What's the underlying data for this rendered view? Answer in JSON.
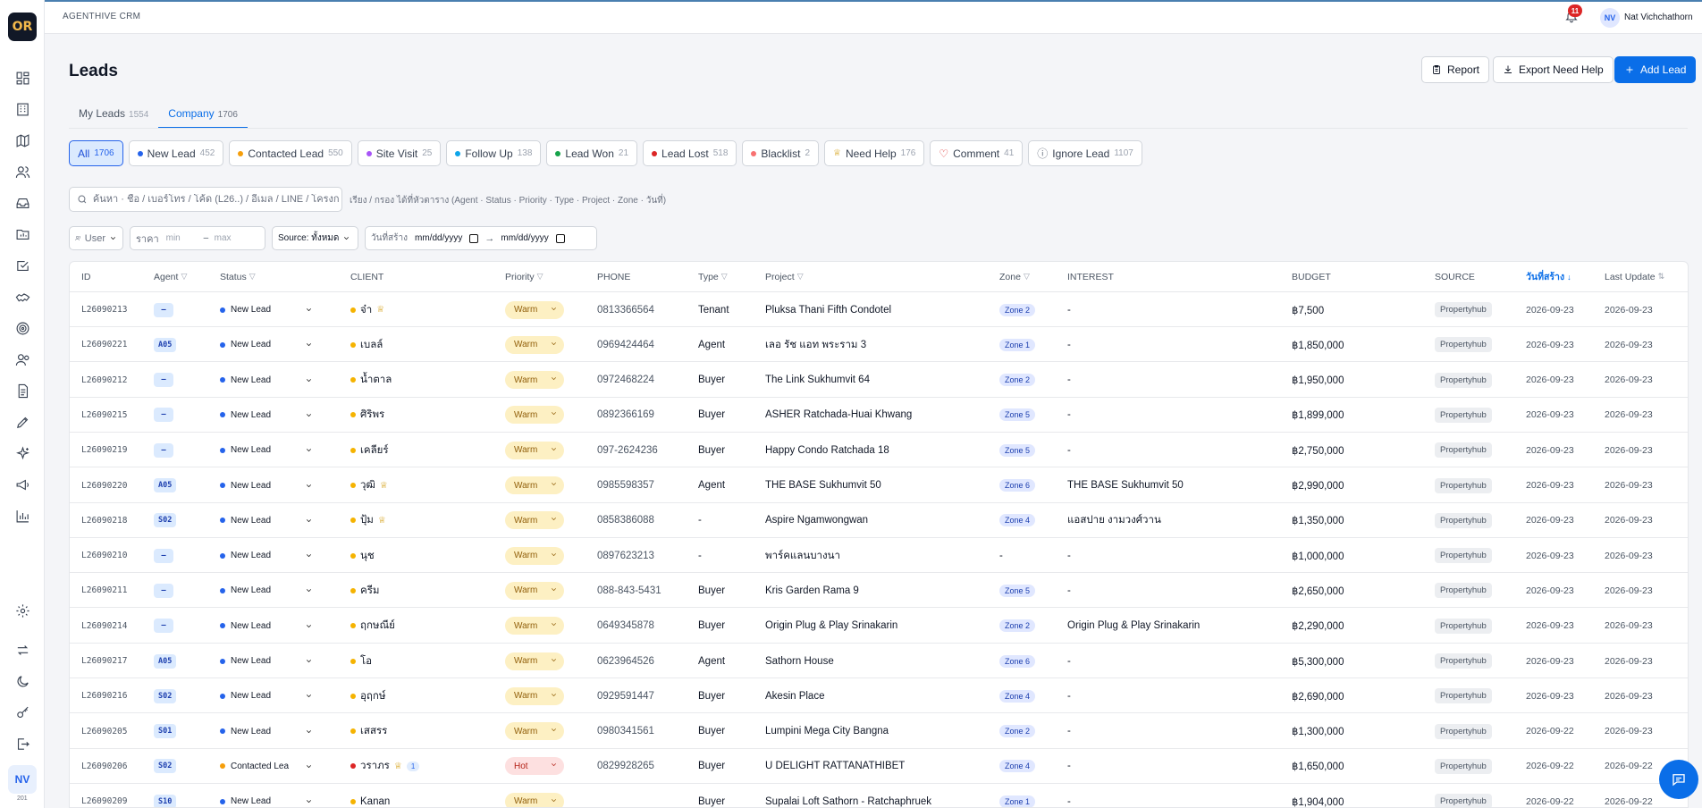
{
  "app": {
    "brand": "AGENTHIVE CRM",
    "logo": "OR",
    "version": "201"
  },
  "header": {
    "notification_count": "11",
    "user_initials": "NV",
    "user_name": "Nat Vichchathorn"
  },
  "page": {
    "title": "Leads"
  },
  "actions": {
    "report": "Report",
    "export": "Export Need Help",
    "add": "Add Lead"
  },
  "tabs": [
    {
      "label": "My Leads",
      "count": "1554"
    },
    {
      "label": "Company",
      "count": "1706"
    }
  ],
  "status_filters": [
    {
      "label": "All",
      "count": "1706",
      "color": ""
    },
    {
      "label": "New Lead",
      "count": "452",
      "color": "#2563eb"
    },
    {
      "label": "Contacted Lead",
      "count": "550",
      "color": "#f59e0b"
    },
    {
      "label": "Site Visit",
      "count": "25",
      "color": "#a855f7"
    },
    {
      "label": "Follow Up",
      "count": "138",
      "color": "#0ea5e9"
    },
    {
      "label": "Lead Won",
      "count": "21",
      "color": "#16a34a"
    },
    {
      "label": "Lead Lost",
      "count": "518",
      "color": "#dc2626"
    },
    {
      "label": "Blacklist",
      "count": "2",
      "color": "#f87171"
    },
    {
      "label": "Need Help",
      "count": "176",
      "color": "#d4a017"
    },
    {
      "label": "Comment",
      "count": "41",
      "color": "#dc2626"
    },
    {
      "label": "Ignore Lead",
      "count": "1107",
      "color": "#6b7280"
    }
  ],
  "search": {
    "placeholder": "ค้นหา · ชื่อ / เบอร์โทร / โค้ด (L26..) / อีเมล / LINE / โครงก",
    "hint": "เรียง / กรอง ได้ที่หัวตาราง (Agent · Status · Priority · Type · Project · Zone · วันที่)"
  },
  "filters": {
    "user": "User",
    "price_label": "ราคา",
    "price_min": "min",
    "price_sep": "–",
    "price_max": "max",
    "source": "Source: ทั้งหมด",
    "created_label": "วันที่สร้าง",
    "date_from": "mm/dd/yyyy",
    "date_arrow": "→",
    "date_to": "mm/dd/yyyy"
  },
  "columns": {
    "id": "ID",
    "agent": "Agent",
    "status": "Status",
    "client": "CLIENT",
    "priority": "Priority",
    "phone": "PHONE",
    "type": "Type",
    "project": "Project",
    "zone": "Zone",
    "interest": "INTEREST",
    "budget": "BUDGET",
    "source": "SOURCE",
    "created": "วันที่สร้าง",
    "updated": "Last Update",
    "filter_glyph": "▽",
    "sort_desc": "↓",
    "sort_both": "⇅"
  },
  "rows": [
    {
      "id": "L26090213",
      "agent": "–",
      "status": "New Lead",
      "status_color": "#2563eb",
      "client": "จ๋า",
      "client_dot": "#f5b301",
      "star": "♕",
      "comment": "",
      "priority": "Warm",
      "phone": "0813366564",
      "type": "Tenant",
      "project": "Pluksa Thani Fifth Condotel",
      "zone": "Zone 2",
      "interest": "-",
      "budget": "฿7,500",
      "source": "Propertyhub",
      "created": "2026-09-23",
      "updated": "2026-09-23"
    },
    {
      "id": "L26090221",
      "agent": "A05",
      "status": "New Lead",
      "status_color": "#2563eb",
      "client": "เบลล์",
      "client_dot": "#f5b301",
      "star": "",
      "comment": "",
      "priority": "Warm",
      "phone": "0969424464",
      "type": "Agent",
      "project": "เลอ รัช แอท พระราม 3",
      "zone": "Zone 1",
      "interest": "-",
      "budget": "฿1,850,000",
      "source": "Propertyhub",
      "created": "2026-09-23",
      "updated": "2026-09-23"
    },
    {
      "id": "L26090212",
      "agent": "–",
      "status": "New Lead",
      "status_color": "#2563eb",
      "client": "น้ำตาล",
      "client_dot": "#f5b301",
      "star": "",
      "comment": "",
      "priority": "Warm",
      "phone": "0972468224",
      "type": "Buyer",
      "project": "The Link Sukhumvit 64",
      "zone": "Zone 2",
      "interest": "-",
      "budget": "฿1,950,000",
      "source": "Propertyhub",
      "created": "2026-09-23",
      "updated": "2026-09-23"
    },
    {
      "id": "L26090215",
      "agent": "–",
      "status": "New Lead",
      "status_color": "#2563eb",
      "client": "ศิริพร",
      "client_dot": "#f5b301",
      "star": "",
      "comment": "",
      "priority": "Warm",
      "phone": "0892366169",
      "type": "Buyer",
      "project": "ASHER Ratchada-Huai Khwang",
      "zone": "Zone 5",
      "interest": "-",
      "budget": "฿1,899,000",
      "source": "Propertyhub",
      "created": "2026-09-23",
      "updated": "2026-09-23"
    },
    {
      "id": "L26090219",
      "agent": "–",
      "status": "New Lead",
      "status_color": "#2563eb",
      "client": "เคลียร์",
      "client_dot": "#f5b301",
      "star": "",
      "comment": "",
      "priority": "Warm",
      "phone": "097-2624236",
      "type": "Buyer",
      "project": "Happy Condo Ratchada 18",
      "zone": "Zone 5",
      "interest": "-",
      "budget": "฿2,750,000",
      "source": "Propertyhub",
      "created": "2026-09-23",
      "updated": "2026-09-23"
    },
    {
      "id": "L26090220",
      "agent": "A05",
      "status": "New Lead",
      "status_color": "#2563eb",
      "client": "วุฒิ",
      "client_dot": "#f5b301",
      "star": "♕",
      "comment": "",
      "priority": "Warm",
      "phone": "0985598357",
      "type": "Agent",
      "project": "THE BASE Sukhumvit 50",
      "zone": "Zone 6",
      "interest": "THE BASE Sukhumvit 50",
      "budget": "฿2,990,000",
      "source": "Propertyhub",
      "created": "2026-09-23",
      "updated": "2026-09-23"
    },
    {
      "id": "L26090218",
      "agent": "S02",
      "status": "New Lead",
      "status_color": "#2563eb",
      "client": "ปุ้ม",
      "client_dot": "#f5b301",
      "star": "♕",
      "comment": "",
      "priority": "Warm",
      "phone": "0858386088",
      "type": "-",
      "project": "Aspire Ngamwongwan",
      "zone": "Zone 4",
      "interest": "แอสปาย งามวงศ์วาน",
      "budget": "฿1,350,000",
      "source": "Propertyhub",
      "created": "2026-09-23",
      "updated": "2026-09-23"
    },
    {
      "id": "L26090210",
      "agent": "–",
      "status": "New Lead",
      "status_color": "#2563eb",
      "client": "นุช",
      "client_dot": "#f5b301",
      "star": "",
      "comment": "",
      "priority": "Warm",
      "phone": "0897623213",
      "type": "-",
      "project": "พาร์คแลนบางนา",
      "zone": "",
      "zone_text": "-",
      "interest": "-",
      "budget": "฿1,000,000",
      "source": "Propertyhub",
      "created": "2026-09-23",
      "updated": "2026-09-23"
    },
    {
      "id": "L26090211",
      "agent": "–",
      "status": "New Lead",
      "status_color": "#2563eb",
      "client": "ครีม",
      "client_dot": "#f5b301",
      "star": "",
      "comment": "",
      "priority": "Warm",
      "phone": "088-843-5431",
      "type": "Buyer",
      "project": "Kris Garden Rama 9",
      "zone": "Zone 5",
      "interest": "-",
      "budget": "฿2,650,000",
      "source": "Propertyhub",
      "created": "2026-09-23",
      "updated": "2026-09-23"
    },
    {
      "id": "L26090214",
      "agent": "–",
      "status": "New Lead",
      "status_color": "#2563eb",
      "client": "ฤกษณีย์",
      "client_dot": "#f5b301",
      "star": "",
      "comment": "",
      "priority": "Warm",
      "phone": "0649345878",
      "type": "Buyer",
      "project": "Origin Plug & Play Srinakarin",
      "zone": "Zone 2",
      "interest": "Origin Plug & Play Srinakarin",
      "budget": "฿2,290,000",
      "source": "Propertyhub",
      "created": "2026-09-23",
      "updated": "2026-09-23"
    },
    {
      "id": "L26090217",
      "agent": "A05",
      "status": "New Lead",
      "status_color": "#2563eb",
      "client": "โอ",
      "client_dot": "#f5b301",
      "star": "",
      "comment": "",
      "priority": "Warm",
      "phone": "0623964526",
      "type": "Agent",
      "project": "Sathorn House",
      "zone": "Zone 6",
      "interest": "-",
      "budget": "฿5,300,000",
      "source": "Propertyhub",
      "created": "2026-09-23",
      "updated": "2026-09-23"
    },
    {
      "id": "L26090216",
      "agent": "S02",
      "status": "New Lead",
      "status_color": "#2563eb",
      "client": "อุฤกษ์",
      "client_dot": "#f5b301",
      "star": "",
      "comment": "",
      "priority": "Warm",
      "phone": "0929591447",
      "type": "Buyer",
      "project": "Akesin Place",
      "zone": "Zone 4",
      "interest": "-",
      "budget": "฿2,690,000",
      "source": "Propertyhub",
      "created": "2026-09-23",
      "updated": "2026-09-23"
    },
    {
      "id": "L26090205",
      "agent": "S01",
      "status": "New Lead",
      "status_color": "#2563eb",
      "client": "เสสรร",
      "client_dot": "#f5b301",
      "star": "",
      "comment": "",
      "priority": "Warm",
      "phone": "0980341561",
      "type": "Buyer",
      "project": "Lumpini Mega City Bangna",
      "zone": "Zone 2",
      "interest": "-",
      "budget": "฿1,300,000",
      "source": "Propertyhub",
      "created": "2026-09-22",
      "updated": "2026-09-23"
    },
    {
      "id": "L26090206",
      "agent": "S02",
      "status": "Contacted Lea",
      "status_color": "#f59e0b",
      "client": "วราภร",
      "client_dot": "#dc2626",
      "star": "♕",
      "comment": "1",
      "priority": "Hot",
      "phone": "0829928265",
      "type": "Buyer",
      "project": "U DELIGHT RATTANATHIBET",
      "zone": "Zone 4",
      "interest": "-",
      "budget": "฿1,650,000",
      "source": "Propertyhub",
      "created": "2026-09-22",
      "updated": "2026-09-22"
    },
    {
      "id": "L26090209",
      "agent": "S10",
      "status": "New Lead",
      "status_color": "#2563eb",
      "client": "Kanan",
      "client_dot": "#f5b301",
      "star": "",
      "comment": "",
      "priority": "Warm",
      "phone": "",
      "type": "Buyer",
      "project": "Supalai Loft Sathorn - Ratchaphruek",
      "zone": "Zone 1",
      "interest": "-",
      "budget": "฿1,904,000",
      "source": "Propertyhub",
      "created": "2026-09-22",
      "updated": "2026-09-22"
    }
  ]
}
